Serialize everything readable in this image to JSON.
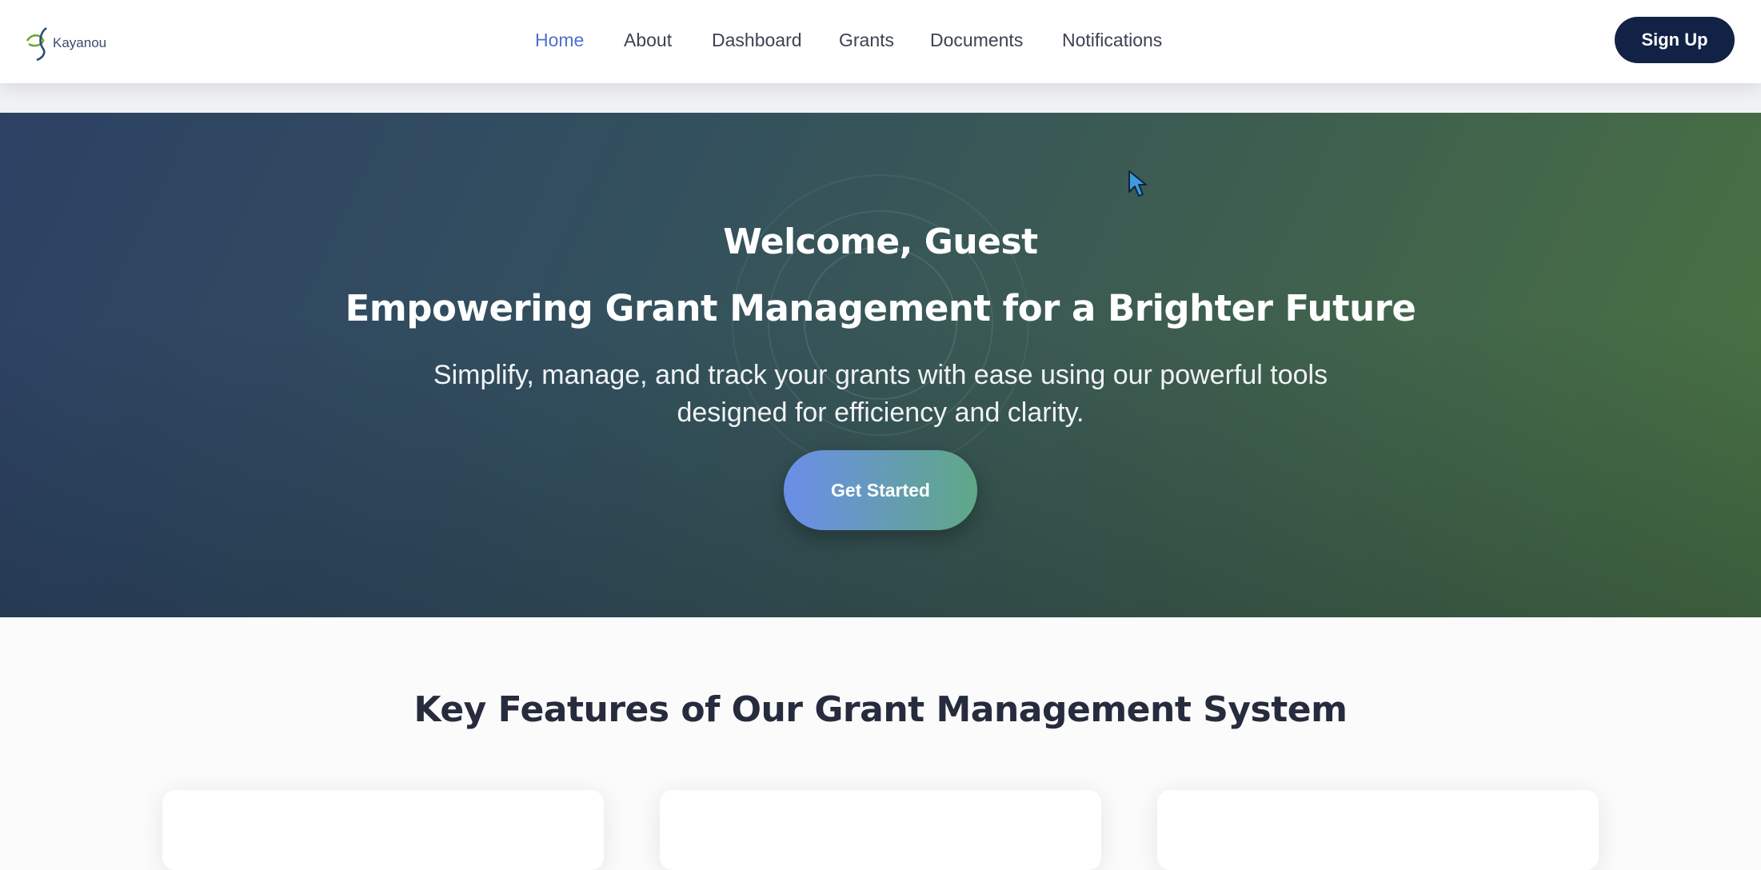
{
  "brand": {
    "logo_text": "Kayanou"
  },
  "nav": {
    "links": [
      {
        "label": "Home",
        "active": true
      },
      {
        "label": "About"
      },
      {
        "label": "Dashboard"
      },
      {
        "label": "Grants"
      },
      {
        "label": "Documents"
      },
      {
        "label": "Notifications"
      }
    ],
    "signup_label": "Sign Up"
  },
  "hero": {
    "welcome": "Welcome, Guest",
    "tagline": "Empowering Grant Management for a Brighter Future",
    "subtitle": "Simplify, manage, and track your grants with ease using our powerful tools designed for efficiency and clarity.",
    "cta_label": "Get Started"
  },
  "features": {
    "title": "Key Features of Our Grant Management System",
    "cards": [
      {},
      {},
      {}
    ]
  },
  "colors": {
    "nav_active": "#4f6fd0",
    "signup_bg": "#112246",
    "hero_start": "#2d4164",
    "hero_end": "#4a7441",
    "cta_start": "#6b8eea",
    "cta_end": "#5fa886"
  }
}
